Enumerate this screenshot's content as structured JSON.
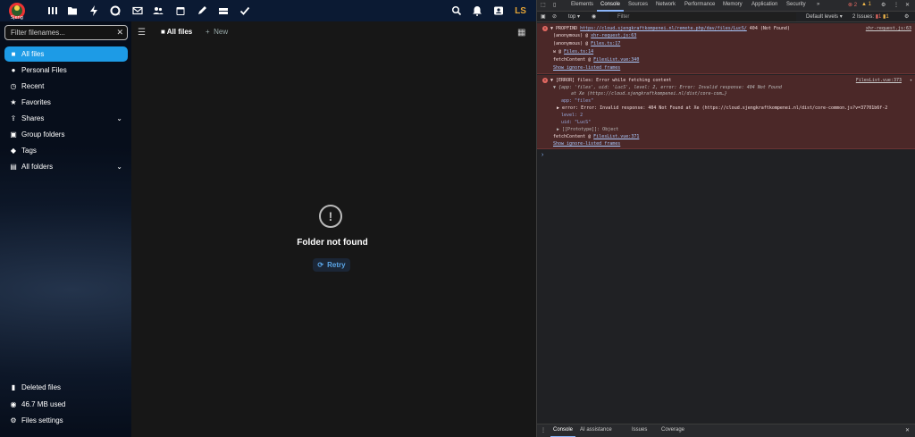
{
  "nextcloud": {
    "logo_text": "Sjeng",
    "header_icons": [
      "dashboard-icon",
      "files-icon",
      "activity-icon",
      "talk-icon",
      "mail-icon",
      "contacts-icon",
      "calendar-icon",
      "notes-icon",
      "deck-icon",
      "tasks-icon"
    ],
    "right_icons": [
      "search-icon",
      "notifications-icon",
      "contacts-menu-icon"
    ],
    "avatar_initials": "LS",
    "filter_placeholder": "Filter filenames...",
    "nav": [
      {
        "label": "All files",
        "active": true,
        "icon": "folder-icon"
      },
      {
        "label": "Personal Files",
        "icon": "person-icon"
      },
      {
        "label": "Recent",
        "icon": "recent-icon"
      },
      {
        "label": "Favorites",
        "icon": "star-icon"
      },
      {
        "label": "Shares",
        "icon": "share-icon",
        "expandable": true
      },
      {
        "label": "Group folders",
        "icon": "group-folder-icon"
      },
      {
        "label": "Tags",
        "icon": "tag-icon"
      },
      {
        "label": "All folders",
        "icon": "folders-icon",
        "expandable": true
      }
    ],
    "footer": {
      "deleted": "Deleted files",
      "quota": "46.7 MB used",
      "settings": "Files settings"
    },
    "breadcrumb": {
      "root": "All files",
      "new_label": "New"
    },
    "empty": {
      "title": "Folder not found",
      "retry": "Retry"
    }
  },
  "devtools": {
    "tabs": [
      "Elements",
      "Console",
      "Sources",
      "Network",
      "Performance",
      "Memory",
      "Application",
      "Security"
    ],
    "active_tab": "Console",
    "counts": {
      "errors": "2",
      "warnings": "1",
      "issues_label": "2 Issues:",
      "issues_errors": "1",
      "issues_warnings": "1"
    },
    "context": "top",
    "filter_placeholder": "Filter",
    "levels": "Default levels",
    "messages": [
      {
        "head": "PROPFIND",
        "url": "https://cloud.sjengkraftkompenei.nl/remote.php/dav/files/LucS/",
        "status": "404 (Not Found)",
        "source": "xhr-request.js:63",
        "stack": [
          {
            "fn": "(anonymous)",
            "at": "xhr-request.js:63"
          },
          {
            "fn": "(anonymous)",
            "at": "Files.ts:17"
          },
          {
            "fn": "w",
            "at": "Files.ts:14"
          },
          {
            "fn": "fetchContent",
            "at": "FilesList.vue:340"
          }
        ],
        "show_frames": "Show ignore-listed frames"
      },
      {
        "head": "[ERROR] files: Error while fetching content",
        "source": "FilesList.vue:373",
        "summary_1": "{app: 'files', uid: 'LucS', level: 2, error: Error: Invalid response: 404 Not Found",
        "summary_2": "at Xe (https://cloud.sjengkraftkompenei.nl/dist/core-com…}",
        "app": "app: \"files\"",
        "error": "error: Error: Invalid response: 404 Not Found at Xe (https://cloud.sjengkraftkompenei.nl/dist/core-common.js?v=37701b6f-2",
        "level": "level: 2",
        "uid": "uid: \"LucS\"",
        "proto": "[[Prototype]]: Object",
        "fetch": "fetchContent @",
        "fetch_at": "FilesList.vue:371",
        "show_frames": "Show ignore-listed frames"
      }
    ],
    "drawer_tabs": [
      "Console",
      "AI assistance",
      "Issues",
      "Coverage"
    ]
  }
}
